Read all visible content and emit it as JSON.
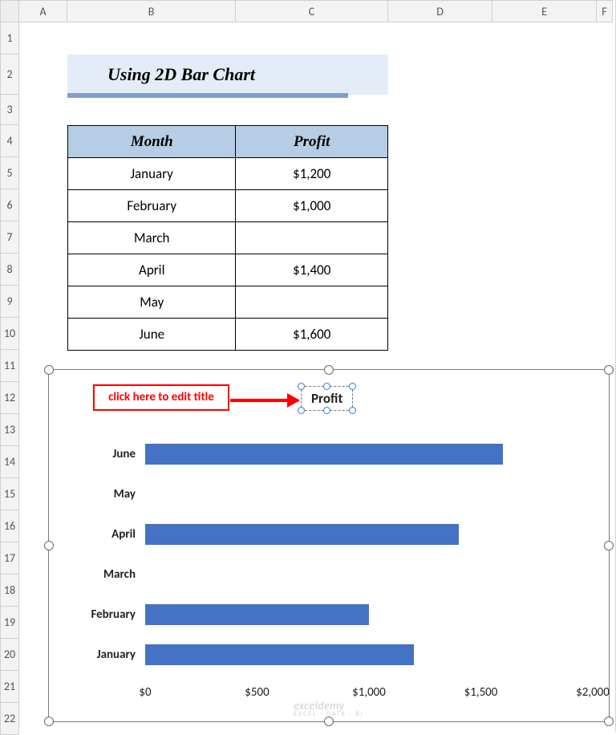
{
  "grid": {
    "col_headers": [
      "A",
      "B",
      "C",
      "D",
      "E",
      "F"
    ],
    "row_headers": [
      "1",
      "2",
      "3",
      "4",
      "5",
      "6",
      "7",
      "8",
      "9",
      "10",
      "11",
      "12",
      "13",
      "14",
      "15",
      "16",
      "17",
      "18",
      "19",
      "20",
      "21",
      "22"
    ]
  },
  "banner_title": "Using 2D Bar Chart",
  "table": {
    "headers": [
      "Month",
      "Profit"
    ],
    "rows": [
      {
        "month": "January",
        "profit": "$1,200"
      },
      {
        "month": "February",
        "profit": "$1,000"
      },
      {
        "month": "March",
        "profit": ""
      },
      {
        "month": "April",
        "profit": "$1,400"
      },
      {
        "month": "May",
        "profit": ""
      },
      {
        "month": "June",
        "profit": "$1,600"
      }
    ]
  },
  "hint_text": "click here to edit title",
  "chart_title": "Profit",
  "x_ticks": [
    "$0",
    "$500",
    "$1,000",
    "$1,500",
    "$2,000"
  ],
  "bar_labels_top_to_bottom": [
    "June",
    "May",
    "April",
    "March",
    "February",
    "January"
  ],
  "watermark": {
    "main": "exceldemy",
    "sub": "EXCEL · DATA · BI"
  },
  "chart_data": {
    "type": "bar",
    "orientation": "horizontal",
    "title": "Profit",
    "categories": [
      "January",
      "February",
      "March",
      "April",
      "May",
      "June"
    ],
    "values": [
      1200,
      1000,
      null,
      1400,
      null,
      1600
    ],
    "xlabel": "",
    "ylabel": "",
    "xlim": [
      0,
      2000
    ],
    "x_ticks": [
      0,
      500,
      1000,
      1500,
      2000
    ],
    "x_tick_format": "$#,##0"
  }
}
